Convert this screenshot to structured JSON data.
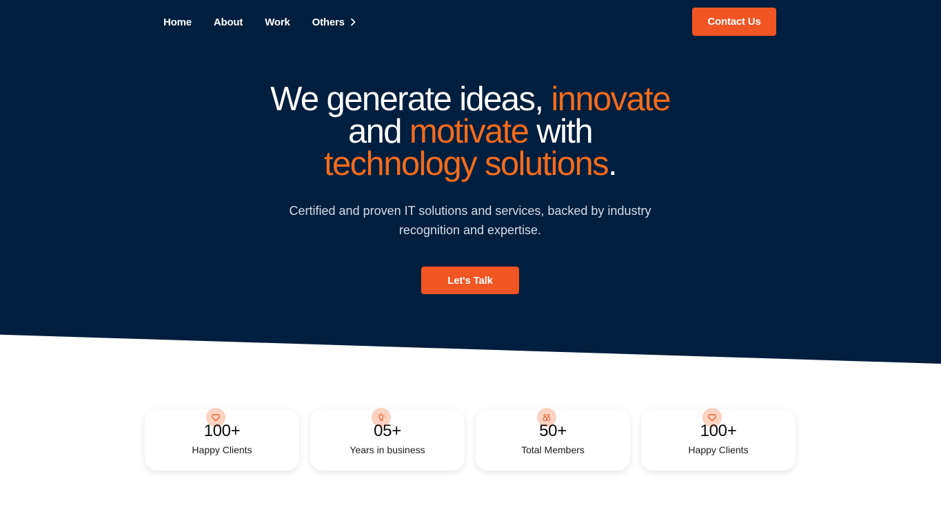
{
  "nav": {
    "items": [
      "Home",
      "About",
      "Work",
      "Others"
    ],
    "cta_label": "Contact Us"
  },
  "hero": {
    "line1_text": "We generate ideas, ",
    "line1_highlight": "innovate",
    "line2_text_a": "and ",
    "line2_highlight": "motivate",
    "line2_text_b": " with",
    "line3_highlight": "technology solutions",
    "line3_end": ".",
    "subtitle": "Certified and proven IT solutions and services, backed by industry recognition and expertise.",
    "cta_label": "Let's Talk"
  },
  "stats": [
    {
      "icon": "heart-icon",
      "value": "100+",
      "label": "Happy Clients"
    },
    {
      "icon": "lightbulb-icon",
      "value": "05+",
      "label": "Years in business"
    },
    {
      "icon": "team-icon",
      "value": "50+",
      "label": "Total Members"
    },
    {
      "icon": "heart-icon",
      "value": "100+",
      "label": "Happy Clients"
    }
  ],
  "colors": {
    "hero_bg": "#001e3d",
    "accent": "#f05523",
    "highlight_text": "#f26b1d",
    "icon_bg": "#fbd3c3"
  }
}
